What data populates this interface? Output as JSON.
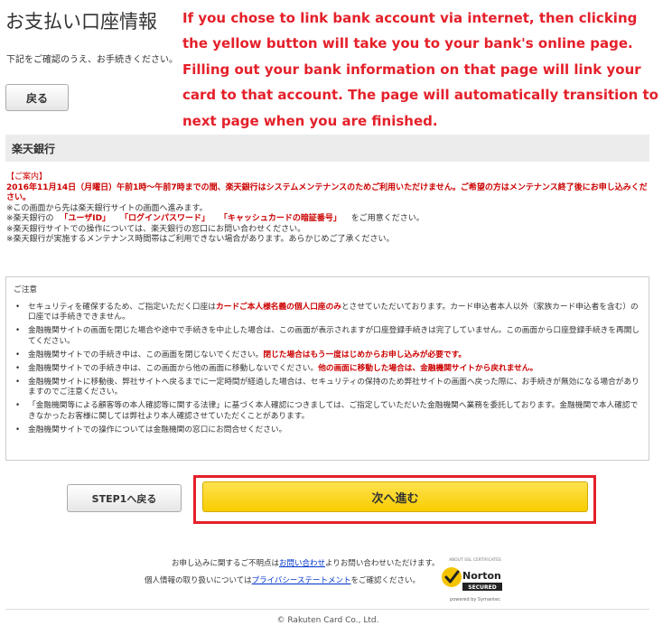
{
  "title": "お支払い口座情報",
  "intro": "下記をご確認のうえ、お手続きください。",
  "back_label": "戻る",
  "annotation": "If you chose to link bank account via internet, then clicking the yellow button will take you to your bank's online page. Filling out your bank information on that page will link your card to that account. The page will automatically transition to next page when you are finished.",
  "bank": {
    "name": "楽天銀行",
    "notice_heading": "【ご案内】",
    "notice_red": "2016年11月14日（月曜日）午前1時〜午前7時までの間、楽天銀行はシステムメンテナンスのためご利用いただけません。ご希望の方はメンテナンス終了後にお申し込みください。",
    "line1": "※この画面から先は楽天銀行サイトの画面へ進みます。",
    "line2_a": "※楽天銀行の",
    "line2_b": "「ユーザID」",
    "line2_c": "「ログインパスワード」",
    "line2_d": "「キャッシュカードの暗証番号」",
    "line2_e": "をご用意ください。",
    "line3": "※楽天銀行サイトでの操作については、楽天銀行の窓口にお問い合わせください。",
    "line4": "※楽天銀行が実施するメンテナンス時間帯はご利用できない場合があります。あらかじめご了承ください。"
  },
  "caution": {
    "title": "ご注意",
    "items": [
      {
        "a": "セキュリティを確保するため、ご指定いただく口座は",
        "red": "カードご本人様名義の個人口座のみ",
        "b": "とさせていただいております。カード申込者本人以外（家族カード申込者を含む）の口座では手続きできません。"
      },
      {
        "a": "金融機関サイトの画面を閉じた場合や途中で手続きを中止した場合は、この画面が表示されますが口座登録手続きは完了していません。この画面から口座登録手続きを再開してください。",
        "red": "",
        "b": ""
      },
      {
        "a": "金融機関サイトでの手続き中は、この画面を閉じないでください。",
        "red": "閉じた場合はもう一度はじめからお申し込みが必要です。",
        "b": ""
      },
      {
        "a": "金融機関サイトでの手続き中は、この画面から他の画面に移動しないでください。",
        "red": "他の画面に移動した場合は、金融機関サイトから戻れません。",
        "b": ""
      },
      {
        "a": "金融機関サイトに移動後、弊社サイトへ戻るまでに一定時間が経過した場合は、セキュリティの保持のため弊社サイトの画面へ戻った際に、お手続きが無効になる場合がありますのでご注意ください。",
        "red": "",
        "b": ""
      },
      {
        "a": "「金融機関等による顧客等の本人確認等に関する法律」に基づく本人確認につきましては、ご指定していただいた金融機関へ業務を委託しております。金融機関で本人確認できなかったお客様に関しては弊社より本人確認させていただくことがあります。",
        "red": "",
        "b": ""
      },
      {
        "a": "金融機関サイトでの操作については金融機関の窓口にお問合せください。",
        "red": "",
        "b": ""
      }
    ]
  },
  "buttons": {
    "step1_back": "STEP1へ戻る",
    "next": "次へ進む"
  },
  "footer": {
    "contact_a": "お申し込みに関するご不明点は",
    "contact_link": "お問い合わせ",
    "contact_b": "よりお問い合わせいただけます。",
    "privacy_a": "個人情報の取り扱いについては",
    "privacy_link": "プライバシーステートメント",
    "privacy_b": "をご確認ください。",
    "copyright": "© Rakuten Card Co., Ltd."
  },
  "norton": {
    "small": "ABOUT SSL CERTIFICATES",
    "brand": "Norton",
    "secured": "SECURED",
    "powered": "powered by Symantec"
  },
  "colors": {
    "annotation_red": "#e4202a",
    "notice_red": "#cc0000",
    "next_yellow": "#f8cd00",
    "link_blue": "#0033cc"
  }
}
